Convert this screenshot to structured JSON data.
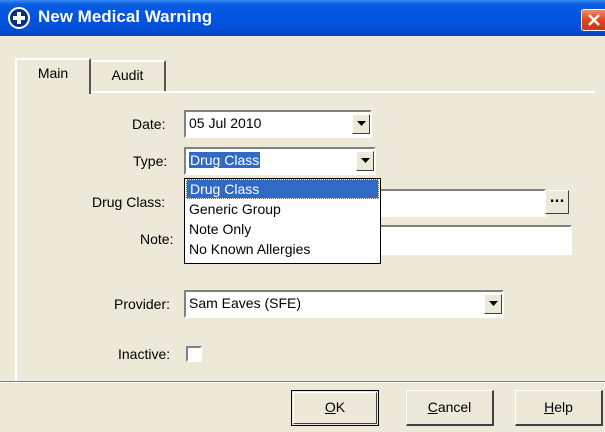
{
  "window": {
    "title": "New Medical Warning"
  },
  "tabs": [
    {
      "label": "Main",
      "active": true
    },
    {
      "label": "Audit",
      "active": false
    }
  ],
  "form": {
    "date": {
      "label": "Date:",
      "value": "05 Jul 2010"
    },
    "type": {
      "label": "Type:",
      "value": "Drug Class",
      "options": [
        "Drug Class",
        "Generic Group",
        "Note Only",
        "No Known Allergies"
      ],
      "highlighted_index": 0
    },
    "drug_class": {
      "label": "Drug Class:",
      "value": "",
      "browse_label": "..."
    },
    "note": {
      "label": "Note:",
      "value": ""
    },
    "provider": {
      "label": "Provider:",
      "value": "Sam Eaves (SFE)"
    },
    "inactive": {
      "label": "Inactive:",
      "checked": false
    }
  },
  "buttons": {
    "ok": {
      "mnemonic": "O",
      "rest": "K"
    },
    "cancel": {
      "mnemonic": "C",
      "rest": "ancel"
    },
    "help": {
      "mnemonic": "H",
      "rest": "elp"
    }
  },
  "colors": {
    "titlebar": "#0054e3",
    "selection": "#316ac5",
    "dialog_bg": "#ece9d8"
  },
  "icons": {
    "app": "plus-circle-icon",
    "close": "close-icon",
    "dropdown": "chevron-down-icon"
  }
}
